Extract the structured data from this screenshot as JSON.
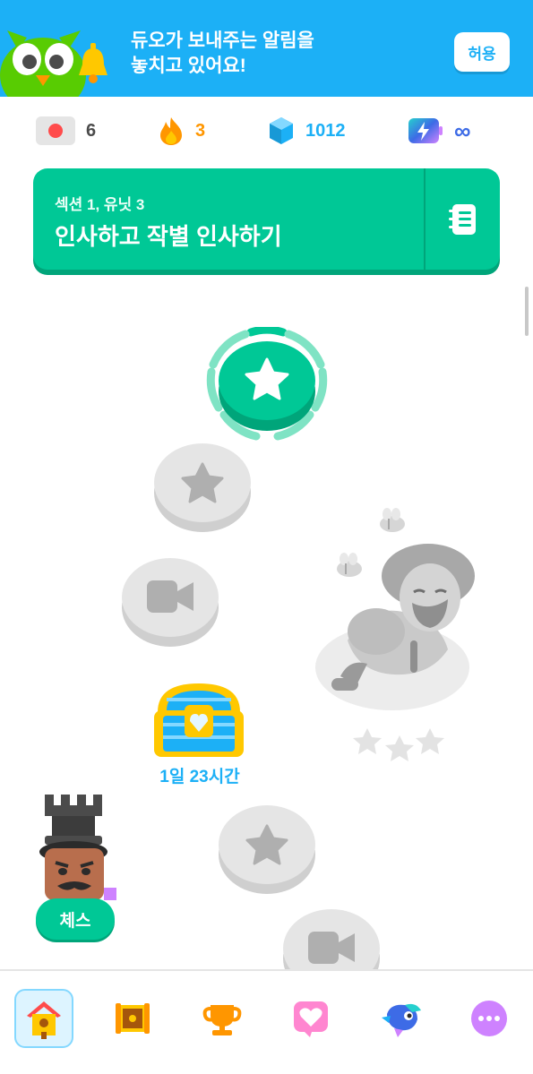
{
  "banner": {
    "line1": "듀오가 보내주는 알림을",
    "line2": "놓치고 있어요!",
    "allow_label": "허용"
  },
  "stats": {
    "language": {
      "icon": "flag-icon",
      "value": "6"
    },
    "streak": {
      "icon": "flame-icon",
      "value": "3",
      "color": "#ff9600"
    },
    "gems": {
      "icon": "gem-icon",
      "value": "1012",
      "color": "#1cb0f6"
    },
    "energy": {
      "icon": "energy-battery-icon",
      "value": "∞",
      "color": "#3d6be6"
    }
  },
  "unit": {
    "subtitle": "섹션 1, 유닛 3",
    "title": "인사하고 작별 인사하기"
  },
  "path": {
    "chest_timer": "1일 23시간",
    "chess_label": "체스"
  },
  "colors": {
    "accent_green": "#00c896",
    "banner_blue": "#1cb0f6",
    "locked_gray": "#e5e5e5"
  },
  "bottom_nav": [
    {
      "icon": "home-icon",
      "active": true
    },
    {
      "icon": "treasure-map-icon",
      "active": false
    },
    {
      "icon": "trophy-icon",
      "active": false
    },
    {
      "icon": "heart-icon",
      "active": false
    },
    {
      "icon": "duo-icon",
      "active": false
    },
    {
      "icon": "more-icon",
      "active": false
    }
  ]
}
